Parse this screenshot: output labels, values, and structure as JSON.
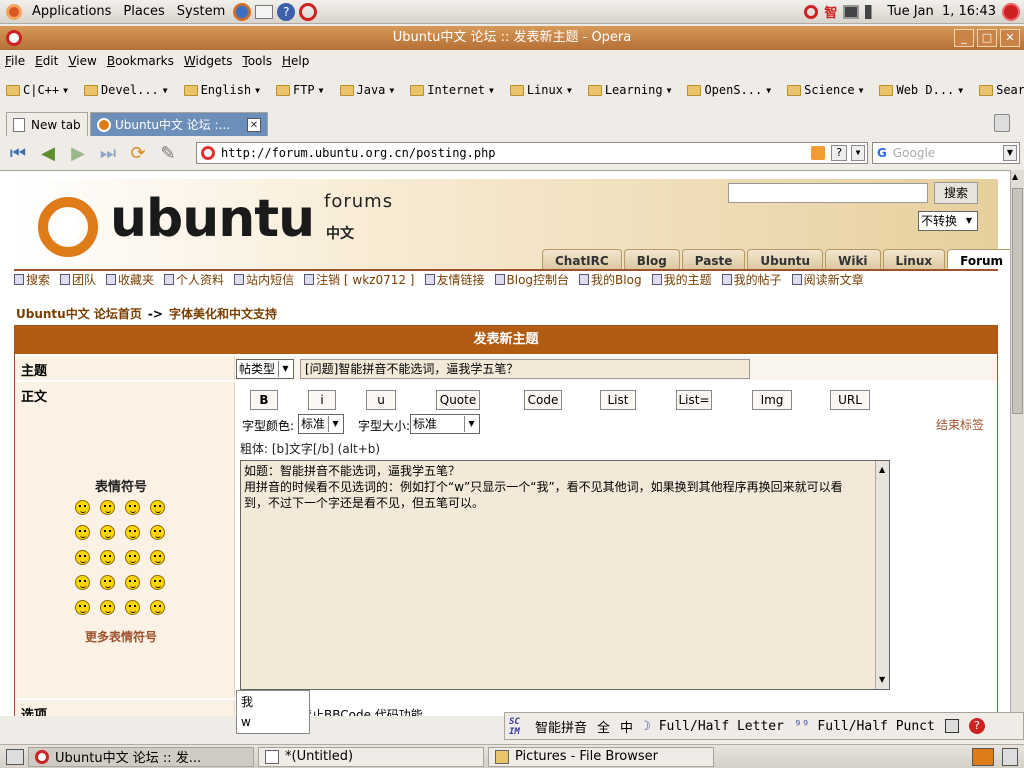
{
  "top_panel": {
    "menus": [
      "Applications",
      "Places",
      "System"
    ],
    "clock": "Tue Jan  1, 16:43",
    "ime_char": "智"
  },
  "window": {
    "title": "Ubuntu中文 论坛 :: 发表新主题 - Opera",
    "menus": [
      "File",
      "Edit",
      "View",
      "Bookmarks",
      "Widgets",
      "Tools",
      "Help"
    ]
  },
  "bookmarks": [
    "C|C++",
    "Devel...",
    "English",
    "FTP",
    "Java",
    "Internet",
    "Linux",
    "Learning",
    "OpenS...",
    "Science",
    "Web D...",
    "Search"
  ],
  "tabs": [
    {
      "label": "New tab"
    },
    {
      "label": "Ubuntu中文 论坛 :..."
    }
  ],
  "address": {
    "url": "http://forum.ubuntu.org.cn/posting.php",
    "search_placeholder": "Google",
    "help": "?"
  },
  "forum": {
    "logo": "ubuntu",
    "forums_word": "forums",
    "cn_word": "中文",
    "search_button": "搜索",
    "convert_option": "不转换",
    "site_tabs": [
      "ChatIRC",
      "Blog",
      "Paste",
      "Ubuntu",
      "Wiki",
      "Linux",
      "Forum"
    ],
    "user_nav": [
      "搜索",
      "团队",
      "收藏夹",
      "个人资料",
      "站内短信",
      "注销 [ wkz0712 ]",
      "友情链接",
      "Blog控制台",
      "我的Blog",
      "我的主题",
      "我的帖子",
      "阅读新文章"
    ],
    "breadcrumb": {
      "home": "Ubuntu中文 论坛首页",
      "sep": "->",
      "section": "字体美化和中文支持"
    }
  },
  "post": {
    "header": "发表新主题",
    "subject_label": "主题",
    "post_type": "帖类型",
    "subject_value": "[问题]智能拼音不能选词，逼我学五笔？",
    "body_label": "正文",
    "smilies_title": "表情符号",
    "more_smilies": "更多表情符号",
    "bbcode_buttons": [
      "B",
      "i",
      "u",
      "Quote",
      "Code",
      "List",
      "List=",
      "Img",
      "URL"
    ],
    "font_color_label": "字型颜色:",
    "font_color_value": "标准",
    "font_size_label": "字型大小:",
    "font_size_value": "标准",
    "close_tags": "结束标签",
    "help_line": "粗体: [b]文字[/b]  (alt+b)",
    "body_lines": [
      "如题：智能拼音不能选词，逼我学五笔？",
      "用拼音的时候看不见选词的：例如打个“w”只显示一个“我”，看不见其他词，如果换到其他程序再换回来就可以看",
      "到，不过下一个字还是看不见，但五笔可以。"
    ],
    "options_label": "选项",
    "options_text": "里禁止BBCode 代码功能"
  },
  "ime_popup": {
    "candidate": "我",
    "input": "w"
  },
  "ime_bar": {
    "mode": "智能拼音",
    "full_char": "全",
    "zh_char": "中",
    "letter": "Full/Half Letter",
    "punct": "Full/Half Punct"
  },
  "taskbar": [
    {
      "label": "Ubuntu中文 论坛 :: 发...",
      "active": true
    },
    {
      "label": "*(Untitled)",
      "active": false
    },
    {
      "label": "Pictures - File Browser",
      "active": false
    }
  ]
}
